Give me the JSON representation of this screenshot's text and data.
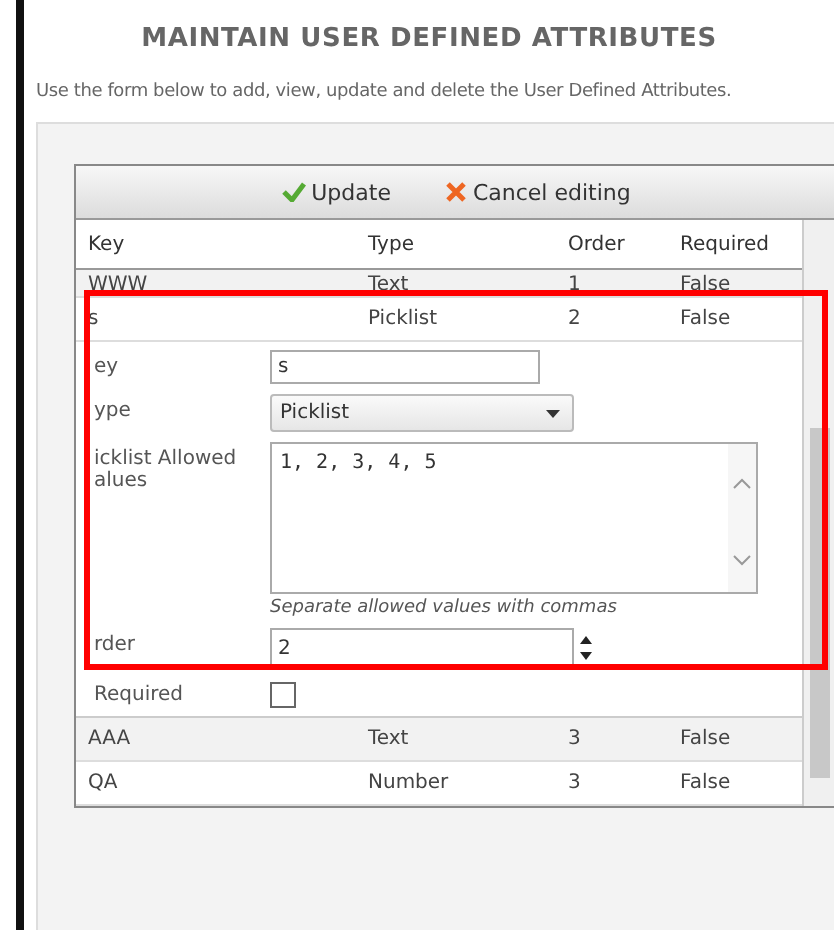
{
  "page": {
    "title": "MAINTAIN USER DEFINED ATTRIBUTES",
    "description": "Use the form below to add, view, update and delete the User Defined Attributes."
  },
  "toolbar": {
    "buttons": [
      {
        "kind": "update",
        "label": "Update"
      },
      {
        "kind": "cancel",
        "label": "Cancel editing"
      }
    ]
  },
  "grid": {
    "columns": [
      "Key",
      "Type",
      "Order",
      "Required"
    ],
    "rows_above": [
      [
        "WWW",
        "Text",
        "1",
        "False"
      ],
      [
        "s",
        "Picklist",
        "2",
        "False"
      ]
    ],
    "edit_form": {
      "fields": [
        {
          "kind": "text",
          "label": "ey",
          "value": "s"
        },
        {
          "kind": "select",
          "label": "ype",
          "value": "Picklist"
        },
        {
          "kind": "textarea",
          "label": "icklist Allowed alues",
          "value": "1, 2, 3, 4, 5",
          "hint": "Separate allowed values with commas"
        },
        {
          "kind": "spinner",
          "label": "rder",
          "value": "2"
        },
        {
          "kind": "checkbox",
          "label": "Required",
          "checked": false
        }
      ]
    },
    "rows_below": [
      [
        "AAA",
        "Text",
        "3",
        "False"
      ],
      [
        "QA",
        "Number",
        "3",
        "False"
      ]
    ]
  }
}
